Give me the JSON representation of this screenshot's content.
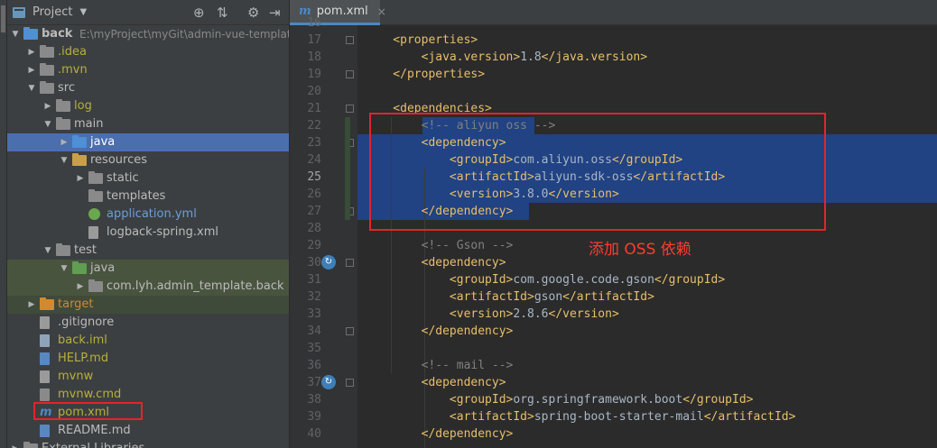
{
  "project_panel": {
    "title": "Project",
    "header_icons": [
      "target-icon",
      "collapse-icon",
      "gear-icon",
      "hide-icon"
    ],
    "tree": [
      {
        "name": "back",
        "path": "E:\\myProject\\myGit\\admin-vue-template\\",
        "level": 0,
        "expanded": true,
        "icon": "module-folder-icon",
        "color": "#bbbbbb"
      },
      {
        "name": ".idea",
        "level": 1,
        "expanded": false,
        "icon": "folder-icon",
        "color": "#b6b03a"
      },
      {
        "name": ".mvn",
        "level": 1,
        "expanded": false,
        "icon": "folder-icon",
        "color": "#b6b03a"
      },
      {
        "name": "src",
        "level": 1,
        "expanded": true,
        "icon": "folder-icon",
        "color": "#bbbbbb"
      },
      {
        "name": "log",
        "level": 2,
        "expanded": false,
        "icon": "folder-icon",
        "color": "#b6b03a"
      },
      {
        "name": "main",
        "level": 2,
        "expanded": true,
        "icon": "folder-icon",
        "color": "#bbbbbb"
      },
      {
        "name": "java",
        "level": 3,
        "expanded": false,
        "icon": "source-folder-icon",
        "color": "#ffffff",
        "selected": true
      },
      {
        "name": "resources",
        "level": 3,
        "expanded": true,
        "icon": "resources-folder-icon",
        "color": "#bbbbbb"
      },
      {
        "name": "static",
        "level": 4,
        "expanded": false,
        "icon": "folder-icon",
        "color": "#bbbbbb"
      },
      {
        "name": "templates",
        "level": 4,
        "icon": "folder-icon",
        "color": "#bbbbbb"
      },
      {
        "name": "application.yml",
        "level": 4,
        "icon": "yml-file-icon",
        "color": "#6a9fd8"
      },
      {
        "name": "logback-spring.xml",
        "level": 4,
        "icon": "xml-file-icon",
        "color": "#bbbbbb"
      },
      {
        "name": "test",
        "level": 2,
        "expanded": true,
        "icon": "folder-icon",
        "color": "#bbbbbb"
      },
      {
        "name": "java",
        "level": 3,
        "expanded": true,
        "icon": "test-folder-icon",
        "color": "#bbbbbb",
        "test": true
      },
      {
        "name": "com.lyh.admin_template.back",
        "level": 4,
        "expanded": false,
        "icon": "package-icon",
        "color": "#bbbbbb",
        "test": true
      },
      {
        "name": "target",
        "level": 1,
        "expanded": false,
        "icon": "excluded-folder-icon",
        "color": "#cc8a33",
        "target": true
      },
      {
        "name": ".gitignore",
        "level": 1,
        "icon": "text-file-icon",
        "color": "#bbbbbb"
      },
      {
        "name": "back.iml",
        "level": 1,
        "icon": "iml-file-icon",
        "color": "#b6b03a"
      },
      {
        "name": "HELP.md",
        "level": 1,
        "icon": "md-file-icon",
        "color": "#b6b03a"
      },
      {
        "name": "mvnw",
        "level": 1,
        "icon": "text-file-icon",
        "color": "#b6b03a"
      },
      {
        "name": "mvnw.cmd",
        "level": 1,
        "icon": "cmd-file-icon",
        "color": "#b6b03a"
      },
      {
        "name": "pom.xml",
        "level": 1,
        "icon": "maven-file-icon",
        "color": "#b6b03a"
      },
      {
        "name": "README.md",
        "level": 1,
        "icon": "md-file-icon",
        "color": "#bbbbbb"
      },
      {
        "name": "External Libraries",
        "level": 0,
        "expanded": false,
        "icon": "libraries-icon",
        "color": "#bbbbbb"
      }
    ]
  },
  "editor": {
    "tab": {
      "icon": "m",
      "name": "pom.xml",
      "close": "×"
    },
    "lines": [
      {
        "num": "16",
        "text": "",
        "partial": true
      },
      {
        "num": "17",
        "tokens": [
          [
            "t",
            "    <properties>"
          ]
        ]
      },
      {
        "num": "18",
        "tokens": [
          [
            "t",
            "        <java.version>"
          ],
          [
            "tx",
            "1.8"
          ],
          [
            "t",
            "</java.version>"
          ]
        ]
      },
      {
        "num": "19",
        "tokens": [
          [
            "t",
            "    </properties>"
          ]
        ]
      },
      {
        "num": "20",
        "tokens": []
      },
      {
        "num": "21",
        "tokens": [
          [
            "t",
            "    <dependencies>"
          ]
        ]
      },
      {
        "num": "22",
        "tokens": [
          [
            "cm",
            "        <!-- aliyun oss -->"
          ]
        ]
      },
      {
        "num": "23",
        "tokens": [
          [
            "t",
            "        <dependency>"
          ]
        ]
      },
      {
        "num": "24",
        "tokens": [
          [
            "t",
            "            <groupId>"
          ],
          [
            "tx",
            "com.aliyun.oss"
          ],
          [
            "t",
            "</groupId>"
          ]
        ]
      },
      {
        "num": "25",
        "tokens": [
          [
            "t",
            "            <artifactId>"
          ],
          [
            "tx",
            "aliyun-sdk-oss"
          ],
          [
            "t",
            "</artifactId>"
          ]
        ]
      },
      {
        "num": "26",
        "tokens": [
          [
            "t",
            "            <version>"
          ],
          [
            "tx",
            "3.8.0"
          ],
          [
            "t",
            "</version>"
          ]
        ]
      },
      {
        "num": "27",
        "tokens": [
          [
            "t",
            "        </dependency>"
          ]
        ]
      },
      {
        "num": "28",
        "tokens": []
      },
      {
        "num": "29",
        "tokens": [
          [
            "cm",
            "        <!-- Gson -->"
          ]
        ]
      },
      {
        "num": "30",
        "tokens": [
          [
            "t",
            "        <dependency>"
          ]
        ]
      },
      {
        "num": "31",
        "tokens": [
          [
            "t",
            "            <groupId>"
          ],
          [
            "tx",
            "com.google.code.gson"
          ],
          [
            "t",
            "</groupId>"
          ]
        ]
      },
      {
        "num": "32",
        "tokens": [
          [
            "t",
            "            <artifactId>"
          ],
          [
            "tx",
            "gson"
          ],
          [
            "t",
            "</artifactId>"
          ]
        ]
      },
      {
        "num": "33",
        "tokens": [
          [
            "t",
            "            <version>"
          ],
          [
            "tx",
            "2.8.6"
          ],
          [
            "t",
            "</version>"
          ]
        ]
      },
      {
        "num": "34",
        "tokens": [
          [
            "t",
            "        </dependency>"
          ]
        ]
      },
      {
        "num": "35",
        "tokens": []
      },
      {
        "num": "36",
        "tokens": [
          [
            "cm",
            "        <!-- mail -->"
          ]
        ]
      },
      {
        "num": "37",
        "tokens": [
          [
            "t",
            "        <dependency>"
          ]
        ]
      },
      {
        "num": "38",
        "tokens": [
          [
            "t",
            "            <groupId>"
          ],
          [
            "tx",
            "org.springframework.boot"
          ],
          [
            "t",
            "</groupId>"
          ]
        ]
      },
      {
        "num": "39",
        "tokens": [
          [
            "t",
            "            <artifactId>"
          ],
          [
            "tx",
            "spring-boot-starter-mail"
          ],
          [
            "t",
            "</artifactId>"
          ]
        ]
      },
      {
        "num": "40",
        "tokens": [
          [
            "t",
            "        </dependency>"
          ]
        ]
      }
    ],
    "current_line": "25",
    "annotation": "添加 OSS 依赖"
  },
  "colors": {
    "tag": "#e8bf6a",
    "comment": "#808080",
    "text": "#a9b7c6",
    "selection": "#214283",
    "highlight_box": "#e0252d"
  }
}
